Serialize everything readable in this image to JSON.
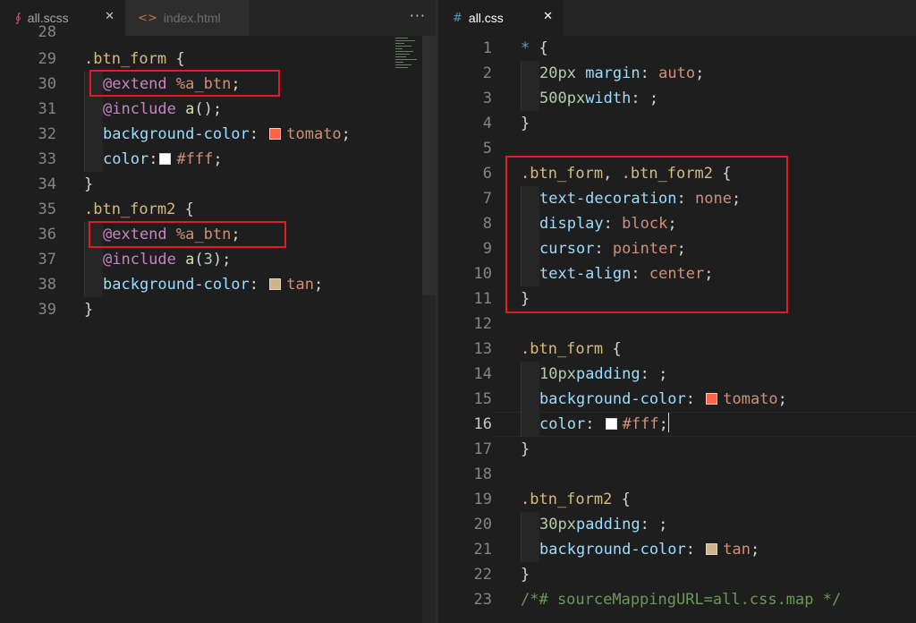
{
  "left_editor": {
    "tabs": [
      {
        "icon": "∮",
        "label": "all.scss",
        "close": "✕"
      },
      {
        "icon": "<>",
        "label": "index.html"
      }
    ],
    "more": "···",
    "top_partial_line": "28",
    "line_numbers": [
      "29",
      "30",
      "31",
      "32",
      "33",
      "34",
      "35",
      "36",
      "37",
      "38",
      "39"
    ],
    "lines": [
      {
        "selector": ".btn_form",
        "brace": " {"
      },
      {
        "keyword": "@extend",
        "value": " %a_btn",
        "end": ";"
      },
      {
        "keyword": "@include",
        "fn": " a",
        "rest": "();"
      },
      {
        "prop": "background-color",
        "colon": ": ",
        "swatch_color": "#ff6347",
        "value": "tomato",
        "end": ";"
      },
      {
        "prop": "color",
        "colon": ":",
        "swatch_color": "#ffffff",
        "value": "#fff",
        "end": ";"
      },
      {
        "brace": "}"
      },
      {
        "selector": ".btn_form2",
        "brace": " {"
      },
      {
        "keyword": "@extend",
        "value": " %a_btn",
        "end": ";"
      },
      {
        "keyword": "@include",
        "fn": " a",
        "paren_open": "(",
        "num": "3",
        "paren_close": ");"
      },
      {
        "prop": "background-color",
        "colon": ": ",
        "swatch_color": "#d2b48c",
        "value": "tan",
        "end": ";"
      },
      {
        "brace": "}"
      }
    ]
  },
  "right_editor": {
    "tab": {
      "icon": "#",
      "label": "all.css",
      "close": "✕"
    },
    "active_line": "16",
    "line_numbers": [
      "1",
      "2",
      "3",
      "4",
      "5",
      "6",
      "7",
      "8",
      "9",
      "10",
      "11",
      "12",
      "13",
      "14",
      "15",
      "16",
      "17",
      "18",
      "19",
      "20",
      "21",
      "22",
      "23"
    ],
    "lines": [
      {
        "star": "*",
        "brace": " {"
      },
      {
        "prop": "margin",
        "colon": ": ",
        "num": "20px",
        "sp": " ",
        "value": "auto",
        "end": ";"
      },
      {
        "prop": "width",
        "colon": ": ",
        "num": "500px",
        "end": ";"
      },
      {
        "brace": "}"
      },
      {},
      {
        "selector": ".btn_form",
        "comma": ", ",
        "selector2": ".btn_form2",
        "brace": " {"
      },
      {
        "prop": "text-decoration",
        "colon": ": ",
        "value": "none",
        "end": ";"
      },
      {
        "prop": "display",
        "colon": ": ",
        "value": "block",
        "end": ";"
      },
      {
        "prop": "cursor",
        "colon": ": ",
        "value": "pointer",
        "end": ";"
      },
      {
        "prop": "text-align",
        "colon": ": ",
        "value": "center",
        "end": ";"
      },
      {
        "brace": "}"
      },
      {},
      {
        "selector": ".btn_form",
        "brace": " {"
      },
      {
        "prop": "padding",
        "colon": ": ",
        "num": "10px",
        "end": ";"
      },
      {
        "prop": "background-color",
        "colon": ": ",
        "swatch_color": "#ff6347",
        "value": "tomato",
        "end": ";"
      },
      {
        "prop": "color",
        "colon": ": ",
        "swatch_color": "#ffffff",
        "value": "#fff",
        "end": ";"
      },
      {
        "brace": "}"
      },
      {},
      {
        "selector": ".btn_form2",
        "brace": " {"
      },
      {
        "prop": "padding",
        "colon": ": ",
        "num": "30px",
        "end": ";"
      },
      {
        "prop": "background-color",
        "colon": ": ",
        "swatch_color": "#d2b48c",
        "value": "tan",
        "end": ";"
      },
      {
        "brace": "}"
      },
      {
        "comment": "/*# sourceMappingURL=all.css.map */"
      }
    ]
  },
  "colors": {
    "highlight_box": "#e31b23",
    "tomato": "#ff6347",
    "tan": "#d2b48c",
    "white": "#ffffff"
  }
}
